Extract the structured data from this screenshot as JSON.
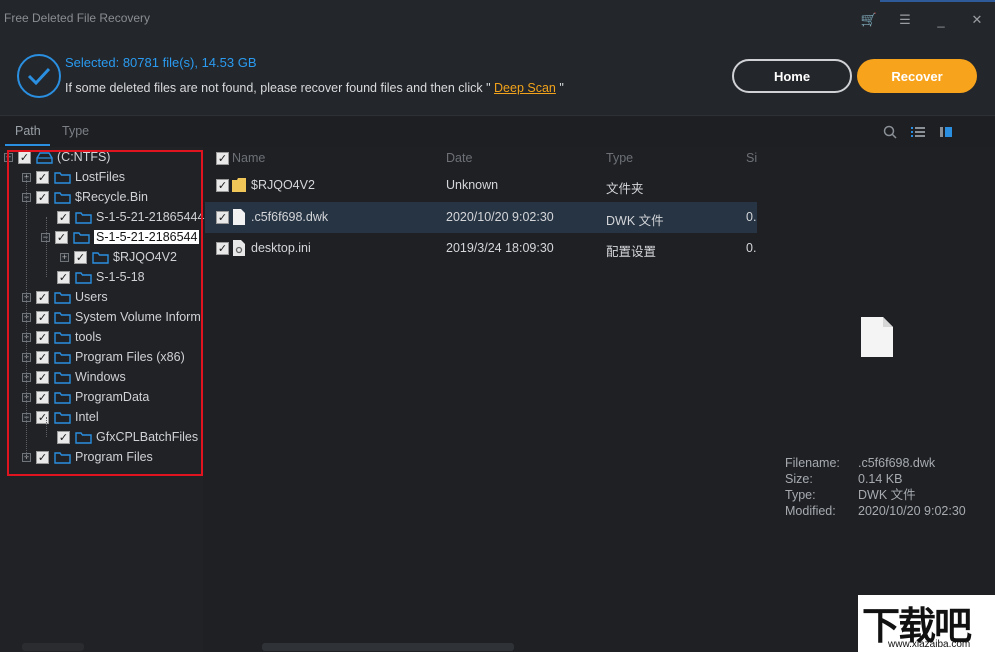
{
  "app": {
    "title": "Free Deleted File Recovery"
  },
  "window_controls": {
    "cart": "🛒",
    "menu": "☰",
    "minimize": "_",
    "close": "✕"
  },
  "header": {
    "selected_text": "Selected: 80781 file(s), 14.53 GB",
    "hint_text": "If some deleted files are not found, please recover found files and then click \"",
    "deep_scan_label": "Deep Scan",
    "hint_suffix": "\"",
    "home_label": "Home",
    "recover_label": "Recover"
  },
  "tabs": {
    "path": "Path",
    "type": "Type"
  },
  "tree": [
    {
      "label": "(C:NTFS)"
    },
    {
      "label": "LostFiles"
    },
    {
      "label": "$Recycle.Bin"
    },
    {
      "label": "S-1-5-21-21865444"
    },
    {
      "label": "S-1-5-21-2186544"
    },
    {
      "label": "$RJQO4V2"
    },
    {
      "label": "S-1-5-18"
    },
    {
      "label": "Users"
    },
    {
      "label": "System Volume Inform"
    },
    {
      "label": "tools"
    },
    {
      "label": "Program Files (x86)"
    },
    {
      "label": "Windows"
    },
    {
      "label": "ProgramData"
    },
    {
      "label": "Intel"
    },
    {
      "label": "GfxCPLBatchFiles"
    },
    {
      "label": "Program Files"
    }
  ],
  "list": {
    "columns": {
      "name": "Name",
      "date": "Date",
      "type": "Type",
      "size": "Si"
    },
    "rows": [
      {
        "name": "$RJQO4V2",
        "date": "Unknown",
        "type": "文件夹",
        "size": ""
      },
      {
        "name": ".c5f6f698.dwk",
        "date": "2020/10/20 9:02:30",
        "type": "DWK 文件",
        "size": "0."
      },
      {
        "name": "desktop.ini",
        "date": "2019/3/24 18:09:30",
        "type": "配置设置",
        "size": "0."
      }
    ]
  },
  "preview": {
    "filename_key": "Filename:",
    "filename_val": ".c5f6f698.dwk",
    "size_key": "Size:",
    "size_val": "0.14 KB",
    "type_key": "Type:",
    "type_val": "DWK 文件",
    "modified_key": "Modified:",
    "modified_val": "2020/10/20 9:02:30"
  },
  "watermark": {
    "big": "下载吧",
    "small": "www.xiazaiba.com"
  },
  "colors": {
    "accent": "#2a8fe0",
    "recover": "#f7a31c",
    "highlight_border": "#e0141e"
  }
}
